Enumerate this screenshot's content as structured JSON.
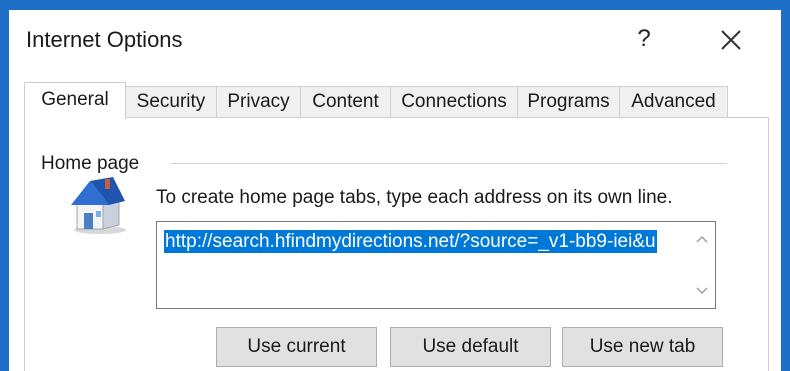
{
  "window": {
    "title": "Internet Options",
    "help_label": "?"
  },
  "tabs": [
    {
      "label": "General",
      "active": true
    },
    {
      "label": "Security"
    },
    {
      "label": "Privacy"
    },
    {
      "label": "Content"
    },
    {
      "label": "Connections"
    },
    {
      "label": "Programs"
    },
    {
      "label": "Advanced"
    }
  ],
  "home_page": {
    "group_label": "Home page",
    "icon": "house-icon",
    "instruction": "To create home page tabs, type each address on its own line.",
    "url_value": "http://search.hfindmydirections.net/?source=_v1-bb9-iei&u",
    "buttons": {
      "use_current": "Use current",
      "use_default": "Use default",
      "use_new_tab": "Use new tab"
    }
  },
  "colors": {
    "selection": "#0078d7",
    "desktop_border": "#1e6fc8"
  }
}
